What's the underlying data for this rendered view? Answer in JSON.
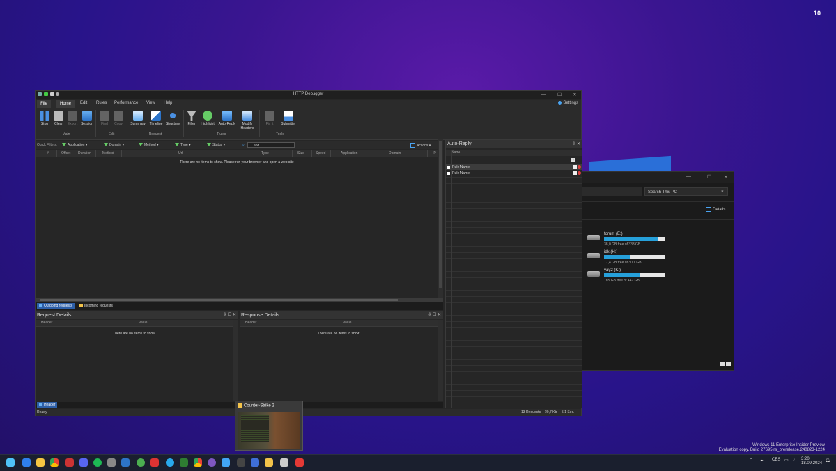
{
  "desktop": {
    "corner_number": "10"
  },
  "explorer": {
    "search_placeholder": "Search This PC",
    "details_label": "Details",
    "drives": [
      {
        "name": "forum (E:)",
        "free": "38,0 GB free of 333 GB",
        "used_fraction": 0.89
      },
      {
        "name": "idk (H:)",
        "free": "17,4 GB free of 30,1 GB",
        "used_fraction": 0.42
      },
      {
        "name": "yay2 (K:)",
        "free": "185 GB free of 447 GB",
        "used_fraction": 0.59
      }
    ]
  },
  "app": {
    "title": "HTTP Debugger",
    "menu": {
      "file": "File",
      "home": "Home",
      "edit": "Edit",
      "rules": "Rules",
      "performance": "Performance",
      "view": "View",
      "help": "Help",
      "settings": "Settings"
    },
    "ribbon": {
      "stop": "Stop",
      "clear": "Clear",
      "export": "Export",
      "session": "Session",
      "find": "Find",
      "copy": "Copy",
      "summary": "Summary",
      "timeline": "Timeline",
      "structure": "Structure",
      "filter": "Filter",
      "highlight": "Highlight",
      "auto_reply": "Auto-Reply",
      "modify_headers": "Modify Headers",
      "fix_it": "Fix It",
      "submitter": "Submitter",
      "groups": {
        "main": "Main",
        "edit": "Edit",
        "request": "Request",
        "rules": "Rules",
        "tools": "Tools"
      }
    },
    "filters": {
      "label": "Quick Filters:",
      "application": "Application",
      "domain": "Domain",
      "method": "Method",
      "type": "Type",
      "status": "Status",
      "search_value": "and",
      "actions": "Actions"
    },
    "columns": [
      "#",
      "Offset",
      "Duration",
      "Method",
      "Url",
      "Type",
      "Size",
      "Speed",
      "Application",
      "Domain",
      "IP"
    ],
    "empty_main": "There are no items to show. Please run your browser and open a web site",
    "tabs": {
      "outgoing": "Outgoing requests",
      "incoming": "Incoming requests"
    },
    "request_details": {
      "title": "Request Details",
      "col_header": "Header",
      "col_value": "Value",
      "empty": "There are no items to show."
    },
    "response_details": {
      "title": "Response Details",
      "col_header": "Header",
      "col_value": "Value",
      "empty": "There are no items to show."
    },
    "bottom_tab": "Header",
    "auto_reply": {
      "title": "Auto-Reply",
      "col_name": "Name",
      "rules": [
        "Rule Name",
        "Rule Name"
      ]
    },
    "status": {
      "ready": "Ready",
      "requests": "13 Requests",
      "size": "20,7 Kb",
      "time": "5,1 Sec."
    }
  },
  "thumbnail": {
    "title": "Counter-Strike 2"
  },
  "watermark": {
    "line1": "Windows 11 Enterprise Insider Preview",
    "line2": "Evaluation copy. Build 27695.rs_prerelease.240823-1224"
  },
  "taskbar": {
    "language": "CES",
    "time": "3:20",
    "date": "18.09.2024"
  }
}
